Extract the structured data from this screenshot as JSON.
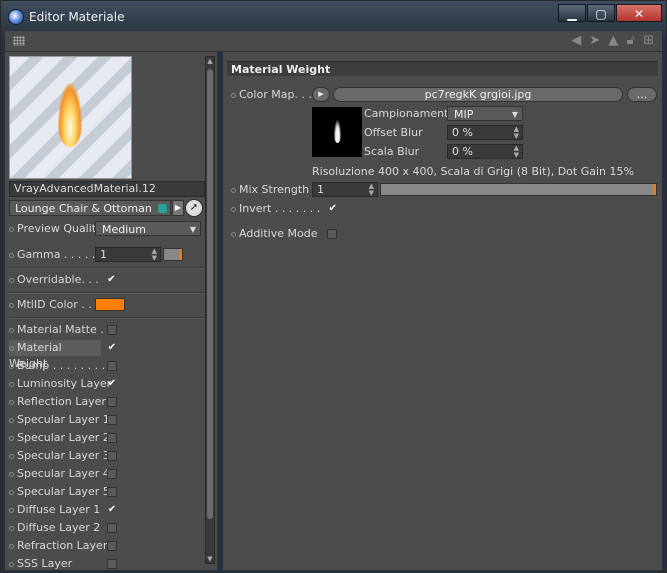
{
  "window": {
    "title": "Editor Materiale",
    "min": "▁",
    "max": "▢",
    "close": "✕"
  },
  "left": {
    "material_name": "VrayAdvancedMaterial.12",
    "object": "Lounge Chair & Ottoman",
    "preview_quality": {
      "label": "Preview Quality",
      "value": "Medium"
    },
    "gamma": {
      "label": "Gamma . . . . .",
      "value": "1"
    },
    "overridable": {
      "label": "Overridable. . .",
      "checked": true
    },
    "mtlid": {
      "label": "MtlID Color . . .",
      "color": "#ff7f00"
    },
    "layers": [
      {
        "label": "Material Matte  . .",
        "checked": false
      },
      {
        "label": "Material Weight",
        "checked": true
      },
      {
        "label": "Bump . . . . . . . . .",
        "checked": false
      },
      {
        "label": "Luminosity Layer",
        "checked": true
      },
      {
        "label": "Reflection Layer",
        "checked": false
      },
      {
        "label": "Specular Layer 1",
        "checked": false
      },
      {
        "label": "Specular Layer 2",
        "checked": false
      },
      {
        "label": "Specular Layer 3",
        "checked": false
      },
      {
        "label": "Specular Layer 4",
        "checked": false
      },
      {
        "label": "Specular Layer 5",
        "checked": false
      },
      {
        "label": "Diffuse Layer 1",
        "checked": true
      },
      {
        "label": "Diffuse Layer 2",
        "checked": false
      },
      {
        "label": "Refraction Layer",
        "checked": false
      },
      {
        "label": "SSS Layer",
        "checked": false
      }
    ]
  },
  "right": {
    "section": "Material Weight",
    "color_map": {
      "label": "Color Map. . . . .",
      "file": "pc7regkK grgioi.jpg",
      "more": "..."
    },
    "campionamento": {
      "label": "Campionamento",
      "value": "MIP"
    },
    "offset_blur": {
      "label": "Offset Blur",
      "value": "0 %"
    },
    "scala_blur": {
      "label": "Scala Blur",
      "value": "0 %"
    },
    "info": "Risoluzione 400 x 400, Scala di Grigi (8 Bit), Dot Gain 15%",
    "mix_strength": {
      "label": "Mix Strength",
      "value": "1"
    },
    "invert": {
      "label": "Invert . . . . . . .",
      "checked": true
    },
    "additive": {
      "label": "Additive Mode",
      "checked": false
    }
  }
}
